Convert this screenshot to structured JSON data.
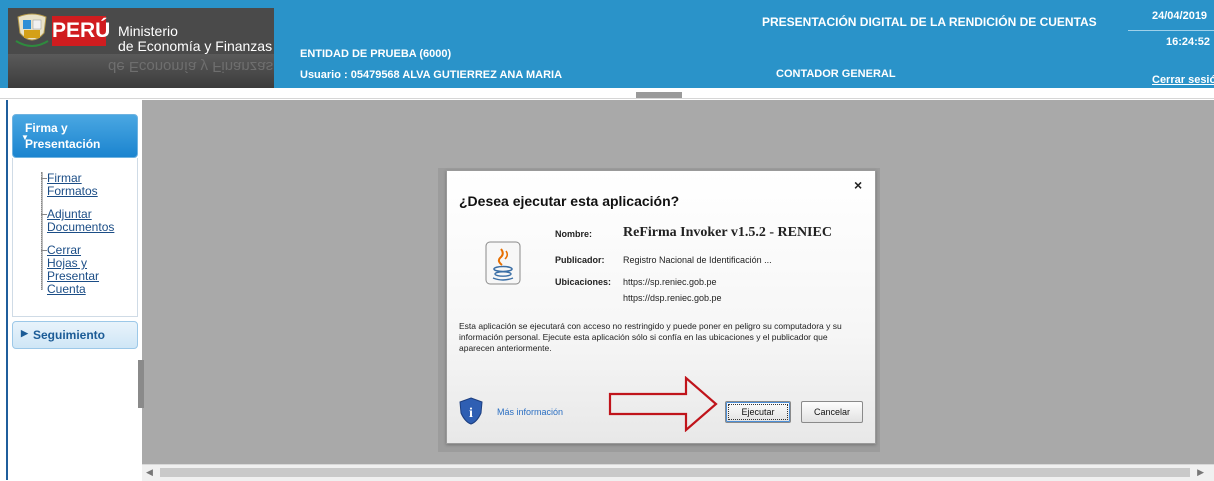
{
  "header": {
    "logo": {
      "country": "PERÚ",
      "line1": "Ministerio",
      "line2": "de Economía y Finanzas",
      "mirror": "de Economía y Finanzas"
    },
    "title": "PRESENTACIÓN DIGITAL DE LA RENDICIÓN DE CUENTAS",
    "date": "24/04/2019",
    "time": "16:24:52",
    "entity": "ENTIDAD DE PRUEBA (6000)",
    "user": "Usuario : 05479568  ALVA GUTIERREZ ANA MARIA",
    "role": "CONTADOR GENERAL",
    "logout": "Cerrar sesión",
    "colors": {
      "bar": "#2a93c9",
      "peru_red": "#d01c1f"
    }
  },
  "sidebar": {
    "section1": {
      "line1": "Firma y",
      "line2": "Presentación"
    },
    "items": [
      {
        "line1": "Firmar",
        "line2": "Formatos",
        "line3": ""
      },
      {
        "line1": "Adjuntar",
        "line2": "Documentos",
        "line3": ""
      },
      {
        "line1": "Cerrar",
        "line2": "Hojas y",
        "line3": "Presentar",
        "line4": "Cuenta"
      }
    ],
    "section2": "Seguimiento"
  },
  "dialog": {
    "close": "×",
    "title": "¿Desea ejecutar esta aplicación?",
    "name_label": "Nombre:",
    "name_value": "ReFirma Invoker v1.5.2 - RENIEC",
    "publisher_label": "Publicador:",
    "publisher_value": "Registro Nacional de Identificación  ...",
    "locations_label": "Ubicaciones:",
    "location1": "https://sp.reniec.gob.pe",
    "location2": "https://dsp.reniec.gob.pe",
    "warning": "Esta aplicación se ejecutará con acceso no restringido y puede poner en peligro su computadora y su información personal. Ejecute esta aplicación sólo si confía en las ubicaciones y el publicador que aparecen anteriormente.",
    "more_info": "Más información",
    "run_button": "Ejecutar",
    "cancel_button": "Cancelar",
    "icons": [
      "java-icon",
      "shield-info-icon",
      "red-arrow-annotation"
    ]
  }
}
